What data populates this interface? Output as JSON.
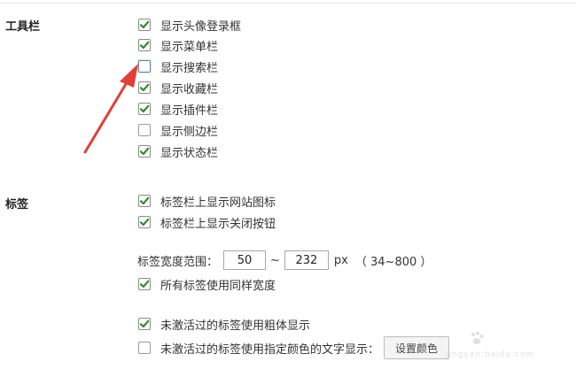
{
  "toolbar_section": {
    "label": "工具栏",
    "items": [
      {
        "label": "显示头像登录框",
        "checked": true
      },
      {
        "label": "显示菜单栏",
        "checked": true
      },
      {
        "label": "显示搜索栏",
        "checked": false
      },
      {
        "label": "显示收藏栏",
        "checked": true
      },
      {
        "label": "显示插件栏",
        "checked": true
      },
      {
        "label": "显示侧边栏",
        "checked": false
      },
      {
        "label": "显示状态栏",
        "checked": true
      }
    ]
  },
  "tabs_section": {
    "label": "标签",
    "show_site_icon": {
      "label": "标签栏上显示网站图标",
      "checked": true
    },
    "show_close_button": {
      "label": "标签栏上显示关闭按钮",
      "checked": true
    },
    "width_range": {
      "label": "标签宽度范围：",
      "min_value": "50",
      "separator": "~",
      "max_value": "232",
      "unit": "px",
      "allowed": "（ 34~800 ）"
    },
    "same_width": {
      "label": "所有标签使用同样宽度",
      "checked": true
    },
    "inactive_bold": {
      "label": "未激活过的标签使用粗体显示",
      "checked": true
    },
    "inactive_color": {
      "label": "未激活过的标签使用指定颜色的文字显示：",
      "checked": false
    },
    "set_color_button": "设置颜色"
  },
  "colors": {
    "check_green": "#2e8b2e",
    "annotation_arrow": "#e0403a"
  },
  "watermark": {
    "text": "Baidu经验",
    "url": "jingyan.baidu.com"
  }
}
